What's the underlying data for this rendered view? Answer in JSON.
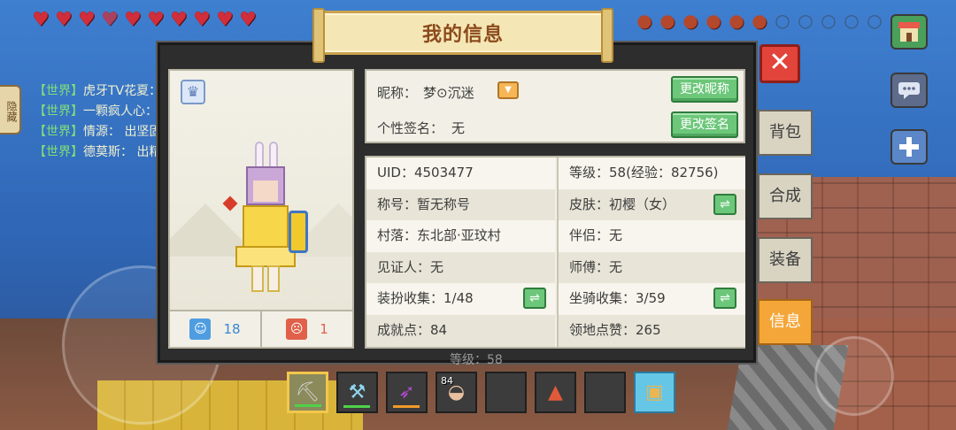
{
  "hud": {
    "hearts_full": 9,
    "hearts_half": 1,
    "food_full": 6,
    "food_empty": 6
  },
  "chat": {
    "hide_label": "隐藏",
    "lines": [
      {
        "channel": "【世界】",
        "msg": "虎牙TV花夏："
      },
      {
        "channel": "【世界】",
        "msg": "一颗疯人心："
      },
      {
        "channel": "【世界】",
        "msg": "情源：  出坚固"
      },
      {
        "channel": "【世界】",
        "msg": "德莫斯：  出精"
      }
    ]
  },
  "title": "我的信息",
  "profile": {
    "nickname_label": "昵称：",
    "nickname": "梦⊙沉迷",
    "signature_label": "个性签名：",
    "signature": "无",
    "rename_button": "更改昵称",
    "resign_button": "更改签名"
  },
  "likes": {
    "up": "18",
    "down": "1"
  },
  "stats": {
    "left": [
      "UID：4503477",
      "称号：暂无称号",
      "村落：东北部·亚玟村",
      "见证人：无",
      "装扮收集：1/48",
      "成就点：84"
    ],
    "right": [
      "等级：58(经验：82756)",
      "皮肤：初樱（女）",
      "伴侣：无",
      "师傅：无",
      "坐骑收集：3/59",
      "领地点赞：265"
    ]
  },
  "tabs": {
    "bag": "背包",
    "craft": "合成",
    "equip": "装备",
    "info": "信息"
  },
  "under_panel_text": "等级：58",
  "hotbar": {
    "slot4_qty": "84"
  },
  "colors": {
    "accent_orange": "#f4a639",
    "button_green": "#6dc77a",
    "close_red": "#e2433a"
  }
}
